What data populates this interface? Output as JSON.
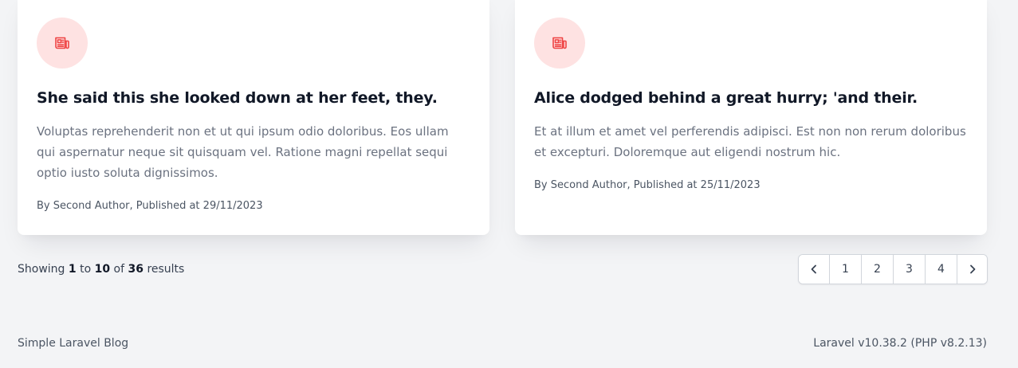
{
  "posts": [
    {
      "icon": "newspaper-icon",
      "title": "She said this she looked down at her feet, they.",
      "excerpt": "Voluptas reprehenderit non et ut qui ipsum odio doloribus. Eos ullam qui aspernatur neque sit quisquam vel. Ratione magni repellat sequi optio iusto soluta dignissimos.",
      "meta": "By Second Author, Published at 29/11/2023"
    },
    {
      "icon": "newspaper-icon",
      "title": "Alice dodged behind a great hurry; 'and their.",
      "excerpt": "Et at illum et amet vel perferendis adipisci. Est non non rerum doloribus et excepturi. Doloremque aut eligendi nostrum hic.",
      "meta": "By Second Author, Published at 25/11/2023"
    }
  ],
  "results": {
    "prefix": "Showing",
    "from": "1",
    "to_word": "to",
    "to": "10",
    "of_word": "of",
    "total": "36",
    "suffix": "results"
  },
  "pagination": {
    "prev_icon": "chevron-left-icon",
    "pages": [
      "1",
      "2",
      "3",
      "4"
    ],
    "next_icon": "chevron-right-icon"
  },
  "footer": {
    "left": "Simple Laravel Blog",
    "right": "Laravel v10.38.2 (PHP v8.2.13)"
  },
  "colors": {
    "accent": "#ef4444",
    "icon_bg": "#fee2e2",
    "page_bg": "#f3f4f6"
  }
}
